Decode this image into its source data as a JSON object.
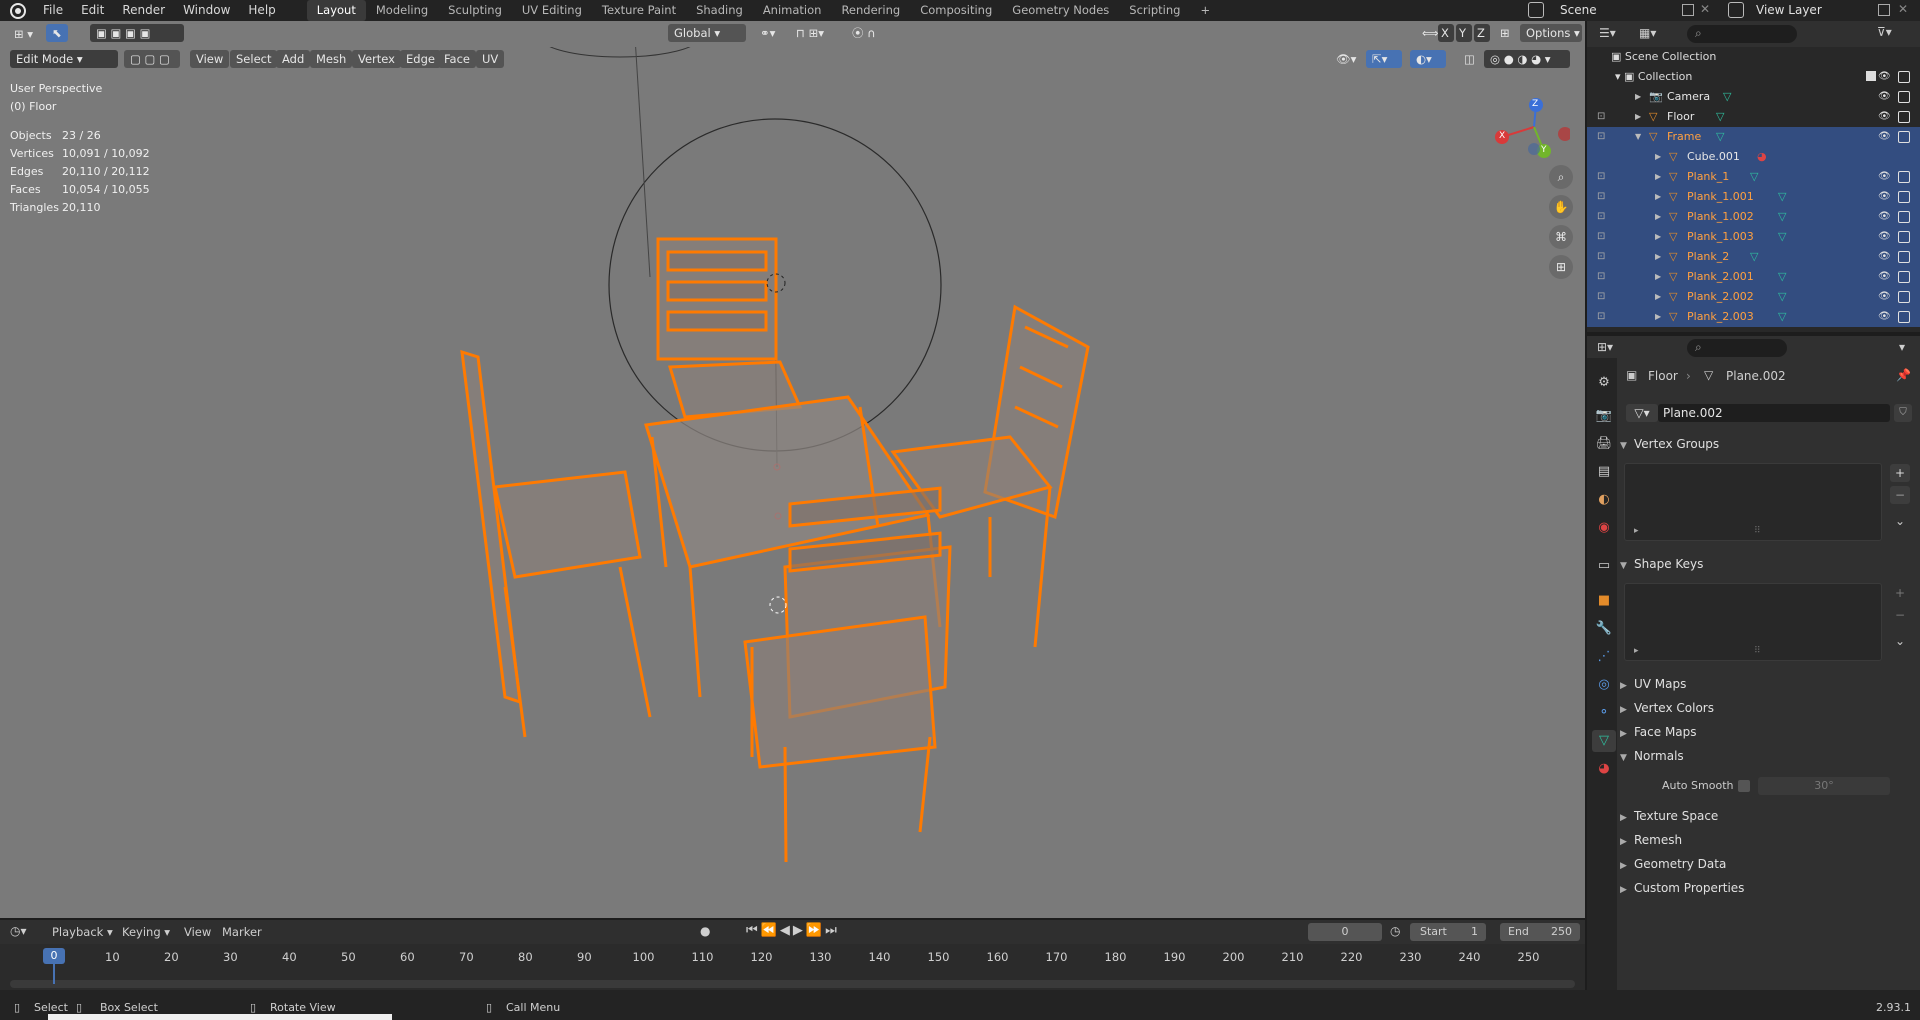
{
  "menu": {
    "file": "File",
    "edit": "Edit",
    "render": "Render",
    "window": "Window",
    "help": "Help"
  },
  "workspaces": [
    "Layout",
    "Modeling",
    "Sculpting",
    "UV Editing",
    "Texture Paint",
    "Shading",
    "Animation",
    "Rendering",
    "Compositing",
    "Geometry Nodes",
    "Scripting"
  ],
  "active_workspace": "Layout",
  "scene": {
    "label": "Scene",
    "view_layer": "View Layer"
  },
  "viewport_header": {
    "transform": "Global",
    "options": "Options",
    "axes": [
      "X",
      "Y",
      "Z"
    ]
  },
  "tool_header": {
    "mode": "Edit Mode",
    "menus": [
      "View",
      "Select",
      "Add",
      "Mesh",
      "Vertex",
      "Edge",
      "Face",
      "UV"
    ]
  },
  "overlay": {
    "perspective": "User Perspective",
    "object": "(0) Floor",
    "stats": [
      {
        "k": "Objects",
        "v": "23 / 26"
      },
      {
        "k": "Vertices",
        "v": "10,091 / 10,092"
      },
      {
        "k": "Edges",
        "v": "20,110 / 20,112"
      },
      {
        "k": "Faces",
        "v": "10,054 / 10,055"
      },
      {
        "k": "Triangles",
        "v": "20,110"
      }
    ]
  },
  "gizmo": {
    "x": "X",
    "y": "Y",
    "z": "Z"
  },
  "outliner": {
    "root": "Scene Collection",
    "collection": "Collection",
    "items": [
      {
        "name": "Camera",
        "type": "camera",
        "selected": false
      },
      {
        "name": "Floor",
        "type": "mesh",
        "selected": false
      },
      {
        "name": "Frame",
        "type": "mesh",
        "selected": true
      },
      {
        "name": "Cube.001",
        "type": "mesh",
        "selected": true
      },
      {
        "name": "Plank_1",
        "type": "mesh",
        "selected": true
      },
      {
        "name": "Plank_1.001",
        "type": "mesh",
        "selected": true
      },
      {
        "name": "Plank_1.002",
        "type": "mesh",
        "selected": true
      },
      {
        "name": "Plank_1.003",
        "type": "mesh",
        "selected": true
      },
      {
        "name": "Plank_2",
        "type": "mesh",
        "selected": true
      },
      {
        "name": "Plank_2.001",
        "type": "mesh",
        "selected": true
      },
      {
        "name": "Plank_2.002",
        "type": "mesh",
        "selected": true
      },
      {
        "name": "Plank_2.003",
        "type": "mesh",
        "selected": true
      }
    ]
  },
  "properties": {
    "breadcrumb_object": "Floor",
    "breadcrumb_data": "Plane.002",
    "data_name": "Plane.002",
    "sections": [
      {
        "label": "Vertex Groups",
        "open": true
      },
      {
        "label": "Shape Keys",
        "open": true
      },
      {
        "label": "UV Maps",
        "open": false
      },
      {
        "label": "Vertex Colors",
        "open": false
      },
      {
        "label": "Face Maps",
        "open": false
      },
      {
        "label": "Normals",
        "open": true
      },
      {
        "label": "Texture Space",
        "open": false
      },
      {
        "label": "Remesh",
        "open": false
      },
      {
        "label": "Geometry Data",
        "open": false
      },
      {
        "label": "Custom Properties",
        "open": false
      }
    ],
    "auto_smooth_label": "Auto Smooth",
    "auto_smooth_angle": "30°"
  },
  "timeline": {
    "menus": [
      "Playback",
      "Keying",
      "View",
      "Marker"
    ],
    "current_frame": "0",
    "start_label": "Start",
    "start": "1",
    "end_label": "End",
    "end": "250",
    "ticks": [
      "0",
      "10",
      "20",
      "30",
      "40",
      "50",
      "60",
      "70",
      "80",
      "90",
      "100",
      "110",
      "120",
      "130",
      "140",
      "150",
      "160",
      "170",
      "180",
      "190",
      "200",
      "210",
      "220",
      "230",
      "240",
      "250"
    ]
  },
  "statusbar": {
    "select": "Select",
    "box_select": "Box Select",
    "rotate": "Rotate View",
    "call_menu": "Call Menu",
    "version": "2.93.1"
  },
  "colors": {
    "selection": "#334d80",
    "edit_orange": "#ff7a00",
    "accent_blue": "#4772b3",
    "viewport_bg": "#7a7a7a"
  }
}
